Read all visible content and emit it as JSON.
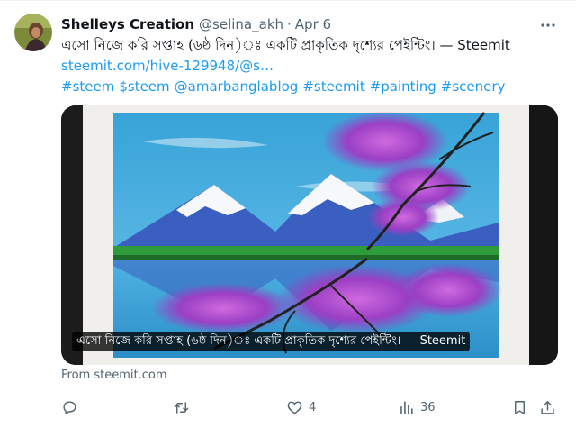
{
  "tweet": {
    "author_name": "Shelleys Creation",
    "handle": "@selina_akh",
    "separator": "·",
    "date": "Apr 6",
    "text": "এসো নিজে করি সপ্তাহ (৬ষ্ঠ দিন)ঃ একটি প্রাকৃতিক দৃশ্যের পেইন্টিং। — Steemit",
    "link": "steemit.com/hive-129948/@s…",
    "hashtags": [
      "#steem",
      "$steem",
      "@amarbanglablog",
      "#steemit",
      "#painting",
      "#scenery"
    ]
  },
  "card": {
    "title": "এসো নিজে করি সপ্তাহ (৬ষ্ঠ দিন)ঃ একটি প্রাকৃতিক দৃশ্যের পেইন্টিং। — Steemit",
    "source": "From steemit.com"
  },
  "actions": {
    "reply": {
      "icon": "reply-icon",
      "count": ""
    },
    "retweet": {
      "icon": "retweet-icon",
      "count": ""
    },
    "like": {
      "icon": "heart-icon",
      "count": "4"
    },
    "views": {
      "icon": "views-chart-icon",
      "count": "36"
    },
    "bookmark": {
      "icon": "bookmark-icon"
    },
    "share": {
      "icon": "share-icon"
    }
  },
  "colors": {
    "link": "#1d9bf0",
    "secondary_text": "#536471",
    "primary_text": "#0f1419"
  }
}
